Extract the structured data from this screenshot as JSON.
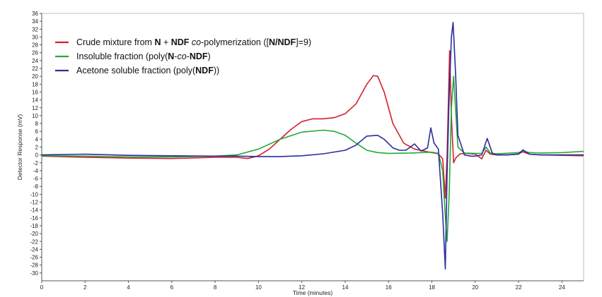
{
  "chart_data": {
    "type": "line",
    "xlabel": "Time (minutes)",
    "ylabel": "Detector Response (mV)",
    "xlim": [
      0,
      25
    ],
    "ylim": [
      -32,
      36
    ],
    "x_ticks": [
      0,
      2,
      4,
      6,
      8,
      10,
      12,
      14,
      16,
      18,
      20,
      22,
      24
    ],
    "y_ticks": [
      36,
      34,
      32,
      30,
      28,
      26,
      24,
      22,
      20,
      18,
      16,
      14,
      12,
      10,
      8,
      6,
      4,
      2,
      0,
      -2,
      -4,
      -6,
      -8,
      -10,
      -12,
      -14,
      -16,
      -18,
      -20,
      -22,
      -24,
      -26,
      -28,
      -30
    ],
    "grid": false,
    "legend_position": "top-left",
    "legend": [
      {
        "segments": [
          {
            "text": "Crude mixture from ",
            "bold": false,
            "italic": false
          },
          {
            "text": "N",
            "bold": true,
            "italic": false
          },
          {
            "text": " + ",
            "bold": false,
            "italic": false
          },
          {
            "text": "NDF",
            "bold": true,
            "italic": false
          },
          {
            "text": " co",
            "bold": false,
            "italic": true
          },
          {
            "text": "-polymerization ([",
            "bold": false,
            "italic": false
          },
          {
            "text": "N/NDF",
            "bold": true,
            "italic": false
          },
          {
            "text": "]=9)",
            "bold": false,
            "italic": false
          }
        ]
      },
      {
        "segments": [
          {
            "text": "Insoluble fraction (poly(",
            "bold": false,
            "italic": false
          },
          {
            "text": "N",
            "bold": true,
            "italic": false
          },
          {
            "text": "-",
            "bold": false,
            "italic": false
          },
          {
            "text": "co",
            "bold": false,
            "italic": true
          },
          {
            "text": "-",
            "bold": false,
            "italic": false
          },
          {
            "text": "NDF",
            "bold": true,
            "italic": false
          },
          {
            "text": ")",
            "bold": false,
            "italic": false
          }
        ]
      },
      {
        "segments": [
          {
            "text": "Acetone soluble fraction (poly(",
            "bold": false,
            "italic": false
          },
          {
            "text": "NDF",
            "bold": true,
            "italic": false
          },
          {
            "text": "))",
            "bold": false,
            "italic": false
          }
        ]
      }
    ],
    "series": [
      {
        "color": "#d42027",
        "x": [
          0,
          2,
          4,
          6,
          8,
          9,
          9.5,
          10,
          10.5,
          11,
          11.5,
          12,
          12.5,
          13,
          13.5,
          14,
          14.5,
          15,
          15.3,
          15.5,
          15.8,
          16.2,
          16.7,
          17.2,
          17.8,
          18.3,
          18.5,
          18.62,
          18.7,
          18.82,
          18.9,
          19.0,
          19.1,
          19.3,
          19.6,
          20,
          20.3,
          20.5,
          20.7,
          21,
          21.5,
          22,
          22.2,
          22.5,
          23,
          24,
          25
        ],
        "y": [
          -0.3,
          -0.6,
          -0.8,
          -0.9,
          -0.6,
          -0.6,
          -0.9,
          -0.2,
          1.5,
          4,
          6.5,
          8.5,
          9.2,
          9.2,
          9.5,
          10.5,
          13,
          18,
          20.2,
          20,
          16,
          8,
          3,
          1.5,
          0.8,
          0.3,
          -1,
          -11,
          0,
          26.5,
          10,
          -2,
          -0.8,
          0.3,
          0.4,
          0.2,
          -1,
          1.2,
          0.2,
          0,
          0,
          0.3,
          0.8,
          0.2,
          0,
          -0.1,
          -0.2
        ]
      },
      {
        "color": "#23a83b",
        "x": [
          0,
          2,
          4,
          6,
          8,
          9,
          10,
          11,
          12,
          13,
          13.5,
          14,
          14.5,
          15,
          15.5,
          16,
          17,
          18,
          18.3,
          18.5,
          18.6,
          18.7,
          18.8,
          18.9,
          19.0,
          19.2,
          19.5,
          20,
          20.3,
          20.5,
          20.7,
          21,
          22,
          22.2,
          22.5,
          23,
          24,
          25
        ],
        "y": [
          -0.2,
          -0.3,
          -0.5,
          -0.5,
          -0.3,
          0,
          1.5,
          4,
          5.8,
          6.3,
          6,
          5,
          3,
          1.2,
          0.6,
          0.4,
          0.5,
          0.7,
          0.4,
          -4,
          -14,
          -22,
          -10,
          12,
          20,
          2,
          0.5,
          0.4,
          0.4,
          2,
          0.5,
          0.3,
          0.6,
          1,
          0.6,
          0.5,
          0.6,
          0.9
        ]
      },
      {
        "color": "#2b2d9c",
        "x": [
          0,
          2,
          4,
          6,
          8,
          9,
          10,
          11,
          12,
          13,
          14,
          14.5,
          15,
          15.5,
          15.8,
          16.2,
          16.5,
          16.8,
          17.2,
          17.5,
          17.8,
          17.95,
          18.1,
          18.3,
          18.5,
          18.62,
          18.7,
          18.8,
          18.9,
          18.98,
          19.1,
          19.2,
          19.5,
          19.8,
          20,
          20.3,
          20.55,
          20.8,
          21,
          21.5,
          22,
          22.2,
          22.5,
          23,
          24,
          25
        ],
        "y": [
          0,
          0.2,
          -0.1,
          -0.2,
          -0.3,
          -0.3,
          -0.4,
          -0.4,
          -0.2,
          0.3,
          1.2,
          2.5,
          4.8,
          5,
          4,
          1.8,
          1.2,
          1.2,
          2.8,
          1,
          1.8,
          6.9,
          3,
          1.5,
          -15,
          -29,
          -5,
          15,
          30,
          33.7,
          20,
          5,
          0,
          -0.3,
          -0.3,
          0,
          4.2,
          0.3,
          0,
          0,
          0.2,
          1.3,
          0.2,
          0,
          0,
          0
        ]
      }
    ]
  }
}
